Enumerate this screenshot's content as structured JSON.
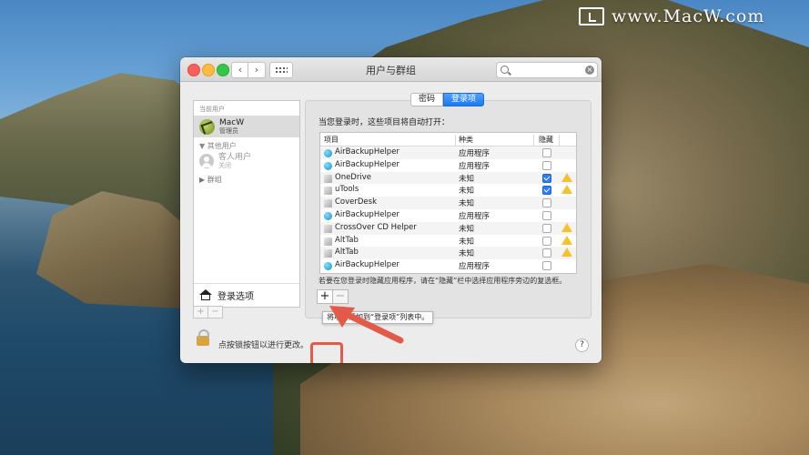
{
  "watermark": {
    "text": "www.MacW.com"
  },
  "window": {
    "title": "用户与群组"
  },
  "sidebar": {
    "current_user_header": "当前用户",
    "user": {
      "name": "MacW",
      "role": "管理员"
    },
    "other_users_header": "其他用户",
    "guest": {
      "name": "客人用户",
      "status": "关闭"
    },
    "groups": "群组",
    "login_options": "登录选项",
    "add": "+",
    "remove": "−"
  },
  "tabs": {
    "password": "密码",
    "login_items": "登录项"
  },
  "description": "当您登录时，这些项目将自动打开：",
  "table": {
    "headers": {
      "item": "项目",
      "kind": "种类",
      "hide": "隐藏"
    },
    "rows": [
      {
        "name": "AirBackupHelper",
        "kind": "应用程序",
        "icon": "globe-icon",
        "hidden": false,
        "warn": false
      },
      {
        "name": "AirBackupHelper",
        "kind": "应用程序",
        "icon": "globe-icon",
        "hidden": false,
        "warn": false
      },
      {
        "name": "OneDrive",
        "kind": "未知",
        "icon": "app-icon",
        "hidden": true,
        "warn": true
      },
      {
        "name": "uTools",
        "kind": "未知",
        "icon": "app-icon",
        "hidden": true,
        "warn": true
      },
      {
        "name": "CoverDesk",
        "kind": "未知",
        "icon": "app-icon",
        "hidden": false,
        "warn": false
      },
      {
        "name": "AirBackupHelper",
        "kind": "应用程序",
        "icon": "globe-icon",
        "hidden": false,
        "warn": false
      },
      {
        "name": "CrossOver CD Helper",
        "kind": "未知",
        "icon": "app-icon",
        "hidden": false,
        "warn": true
      },
      {
        "name": "AltTab",
        "kind": "未知",
        "icon": "app-icon",
        "hidden": false,
        "warn": true
      },
      {
        "name": "AltTab",
        "kind": "未知",
        "icon": "app-icon",
        "hidden": false,
        "warn": true
      },
      {
        "name": "AirBackupHelper",
        "kind": "应用程序",
        "icon": "globe-icon",
        "hidden": false,
        "warn": false
      }
    ]
  },
  "note": "若要在您登录时隐藏应用程序，请在“隐藏”栏中选择应用程序旁边的复选框。",
  "add_button": "+",
  "remove_button": "−",
  "tooltip": "将项目添加到“登录项”列表中。",
  "lock_text": "点按锁按钮以进行更改。",
  "help": "?",
  "colors": {
    "accent": "#1a78f2",
    "warning": "#f4c22b",
    "annotation": "#e35a48"
  }
}
